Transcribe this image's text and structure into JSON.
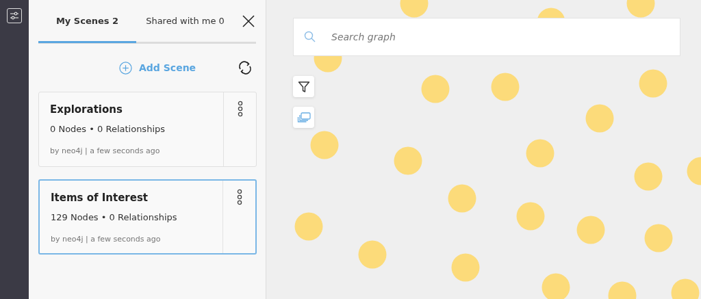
{
  "tabs": [
    {
      "label": "My Scenes 2",
      "selected": true
    },
    {
      "label": "Shared with me 0",
      "selected": false
    }
  ],
  "add_scene": {
    "label": "Add Scene"
  },
  "scenes": [
    {
      "title": "Explorations",
      "stats": "0 Nodes • 0 Relationships",
      "meta": "by neo4j | a few seconds ago",
      "selected": false
    },
    {
      "title": "Items of Interest",
      "stats": "129 Nodes • 0 Relationships",
      "meta": "by neo4j | a few seconds ago",
      "selected": true
    }
  ],
  "search": {
    "placeholder": "Search graph"
  }
}
